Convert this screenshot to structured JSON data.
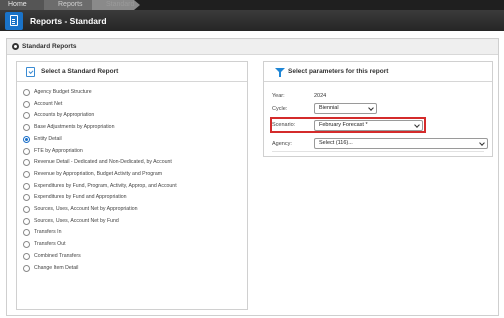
{
  "breadcrumb": {
    "items": [
      "Home",
      "Reports",
      "Standard"
    ]
  },
  "header": {
    "title": "Reports - Standard"
  },
  "panel": {
    "title": "Standard Reports"
  },
  "left_card": {
    "title": "Select a Standard Report",
    "selected": "Entity Detail",
    "reports": [
      "Agency Budget Structure",
      "Account Net",
      "Accounts by Appropriation",
      "Base Adjustments by Appropriation",
      "Entity Detail",
      "FTE by Appropriation",
      "Revenue Detail - Dedicated and Non-Dedicated, by Account",
      "Revenue by Appropriation, Budget Activity and Program",
      "Expenditures by Fund, Program, Activity, Approp, and Account",
      "Expenditures by Fund and Appropriation",
      "Sources, Uses, Account Net by Appropriation",
      "Sources, Uses, Account Net by Fund",
      "Transfers In",
      "Transfers Out",
      "Combined Transfers",
      "Change Item Detail"
    ]
  },
  "right_card": {
    "title": "Select parameters for this report",
    "year_label": "Year:",
    "year_value": "2024",
    "cycle_label": "Cycle:",
    "cycle_value": "Biennial",
    "scenario_label": "Scenario:",
    "scenario_value": "February Forecast *",
    "agency_label": "Agency:",
    "agency_value": "Select (116)..."
  },
  "colors": {
    "accent": "#1a6fc9",
    "highlight": "#d42b2b",
    "titlebar": "#2b2b2b"
  }
}
